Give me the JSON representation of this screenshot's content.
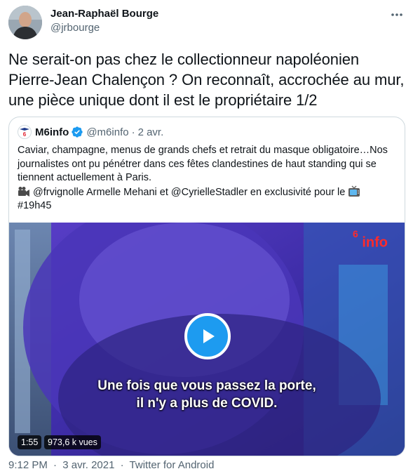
{
  "tweet": {
    "author_name": "Jean-Raphaël Bourge",
    "author_handle": "@jrbourge",
    "more_icon": "more-icon",
    "text": "Ne serait-on pas chez le collectionneur napoléonien Pierre-Jean Chalençon ? On reconnaît, accrochée au mur, une pièce unique dont il est le propriétaire 1/2",
    "timestamp": "9:12 PM",
    "separator": "·",
    "date": "3 avr. 2021",
    "source": "Twitter for Android"
  },
  "quote": {
    "name": "M6info",
    "handle": "@m6info",
    "separator": "·",
    "date": "2 avr.",
    "line1": "Caviar, champagne, menus de grands chefs et retrait du masque obligatoire…Nos",
    "line2": "journalistes ont pu pénétrer dans ces fêtes clandestines de haut standing qui se",
    "line3": "tiennent actuellement à Paris.",
    "line4_mid": "@frvignolle Armelle Mehani et @CyrielleStadler en exclusivité pour le",
    "line5": "#19h45"
  },
  "video": {
    "logo_prefix": "6",
    "logo_text": "info",
    "caption_line1": "Une fois que vous passez la porte,",
    "caption_line2": "il n'y a plus de COVID.",
    "duration": "1:55",
    "views": "973,6 k vues",
    "accent": "#1d9bf0"
  }
}
